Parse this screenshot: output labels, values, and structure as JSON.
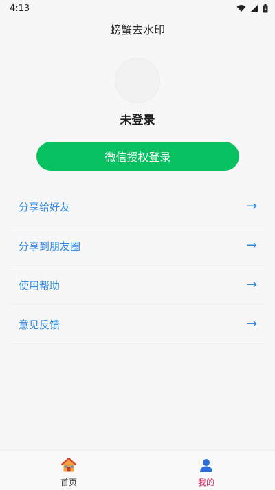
{
  "status_bar": {
    "time": "4:13",
    "icons": [
      "wifi-icon",
      "signal-icon",
      "battery-icon"
    ]
  },
  "header": {
    "title": "螃蟹去水印"
  },
  "profile": {
    "login_status": "未登录"
  },
  "login_button": {
    "label": "微信授权登录",
    "color": "#07c160"
  },
  "menu": {
    "items": [
      {
        "label": "分享给好友",
        "icon": "arrow-right-icon"
      },
      {
        "label": "分享到朋友圈",
        "icon": "arrow-right-icon"
      },
      {
        "label": "使用帮助",
        "icon": "arrow-right-icon"
      },
      {
        "label": "意见反馈",
        "icon": "arrow-right-icon"
      }
    ],
    "arrow_glyph": "→",
    "accent": "#2e8ae6"
  },
  "tab_bar": {
    "tabs": [
      {
        "label": "首页",
        "icon": "house-icon",
        "active": false
      },
      {
        "label": "我的",
        "icon": "person-icon",
        "active": true
      }
    ],
    "active_color": "#e0245e"
  }
}
